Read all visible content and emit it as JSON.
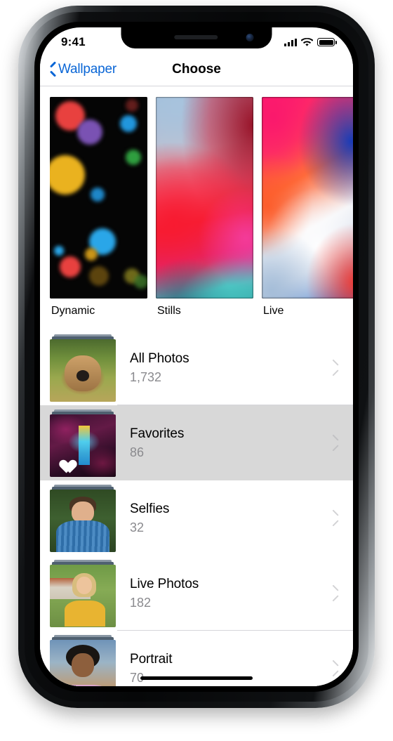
{
  "status_bar": {
    "time": "9:41",
    "signal_icon": "cellular-bars-icon",
    "wifi_icon": "wifi-icon",
    "battery_icon": "battery-full-icon"
  },
  "nav_bar": {
    "back_label": "Wallpaper",
    "back_icon": "chevron-left-icon",
    "title": "Choose"
  },
  "wallpaper_types": [
    {
      "label": "Dynamic",
      "kind": "bokeh"
    },
    {
      "label": "Stills",
      "kind": "stills"
    },
    {
      "label": "Live",
      "kind": "live"
    }
  ],
  "albums": [
    {
      "title": "All Photos",
      "count": "1,732",
      "selected": false,
      "thumb": "dog-photo-thumbnail",
      "badge": ""
    },
    {
      "title": "Favorites",
      "count": "86",
      "selected": true,
      "thumb": "favorites-photo-thumbnail",
      "badge": "heart-icon"
    },
    {
      "title": "Selfies",
      "count": "32",
      "selected": false,
      "thumb": "selfie-photo-thumbnail",
      "badge": ""
    },
    {
      "title": "Live Photos",
      "count": "182",
      "selected": false,
      "thumb": "live-photo-thumbnail",
      "badge": ""
    },
    {
      "title": "Portrait",
      "count": "70",
      "selected": false,
      "thumb": "portrait-photo-thumbnail",
      "badge": ""
    }
  ],
  "colors": {
    "accent_blue": "#0a66d6",
    "selected_row": "#d8d8d8",
    "secondary_text": "#8a8a8e",
    "separator": "#d6d6da"
  },
  "chevron_icon": "chevron-right-icon",
  "home_indicator": "home-indicator"
}
